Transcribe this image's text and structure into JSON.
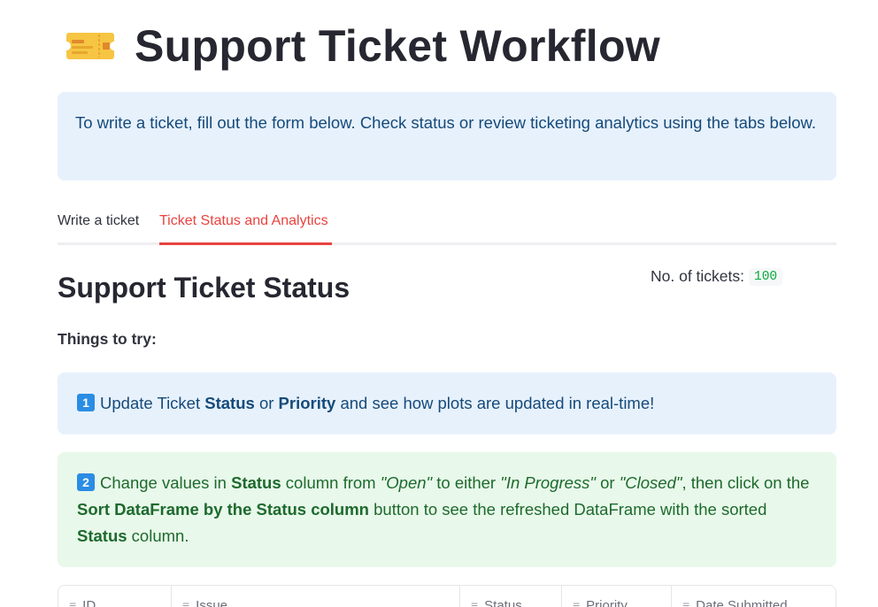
{
  "page": {
    "title": "Support Ticket Workflow",
    "icon": "ticket-icon"
  },
  "info": {
    "text": "To write a ticket, fill out the form below. Check status or review ticketing analytics using the tabs below."
  },
  "tabs": [
    {
      "label": "Write a ticket",
      "active": false
    },
    {
      "label": "Ticket Status and Analytics",
      "active": true
    }
  ],
  "status_section": {
    "title": "Support Ticket Status",
    "count_label": "No. of tickets:",
    "count_value": "100",
    "things_label": "Things to try:"
  },
  "tip1": {
    "badge": "1",
    "p1": "Update Ticket ",
    "b1": "Status",
    "p2": " or ",
    "b2": "Priority",
    "p3": " and see how plots are updated in real-time!"
  },
  "tip2": {
    "badge": "2",
    "p1": "Change values in ",
    "b1": "Status",
    "p2": " column from ",
    "i1": "\"Open\"",
    "p3": " to either ",
    "i2": "\"In Progress\"",
    "p4": " or ",
    "i3": "\"Closed\"",
    "p5": ", then click on the ",
    "b2": "Sort DataFrame by the Status column",
    "p6": " button to see the refreshed DataFrame with the sorted ",
    "b3": "Status",
    "p7": " column."
  },
  "table": {
    "columns": [
      "ID",
      "Issue",
      "Status",
      "Priority",
      "Date Submitted"
    ]
  },
  "colors": {
    "accent": "#e9433f",
    "info_bg": "#e7f1fc",
    "success_bg": "#e8f8ea"
  }
}
